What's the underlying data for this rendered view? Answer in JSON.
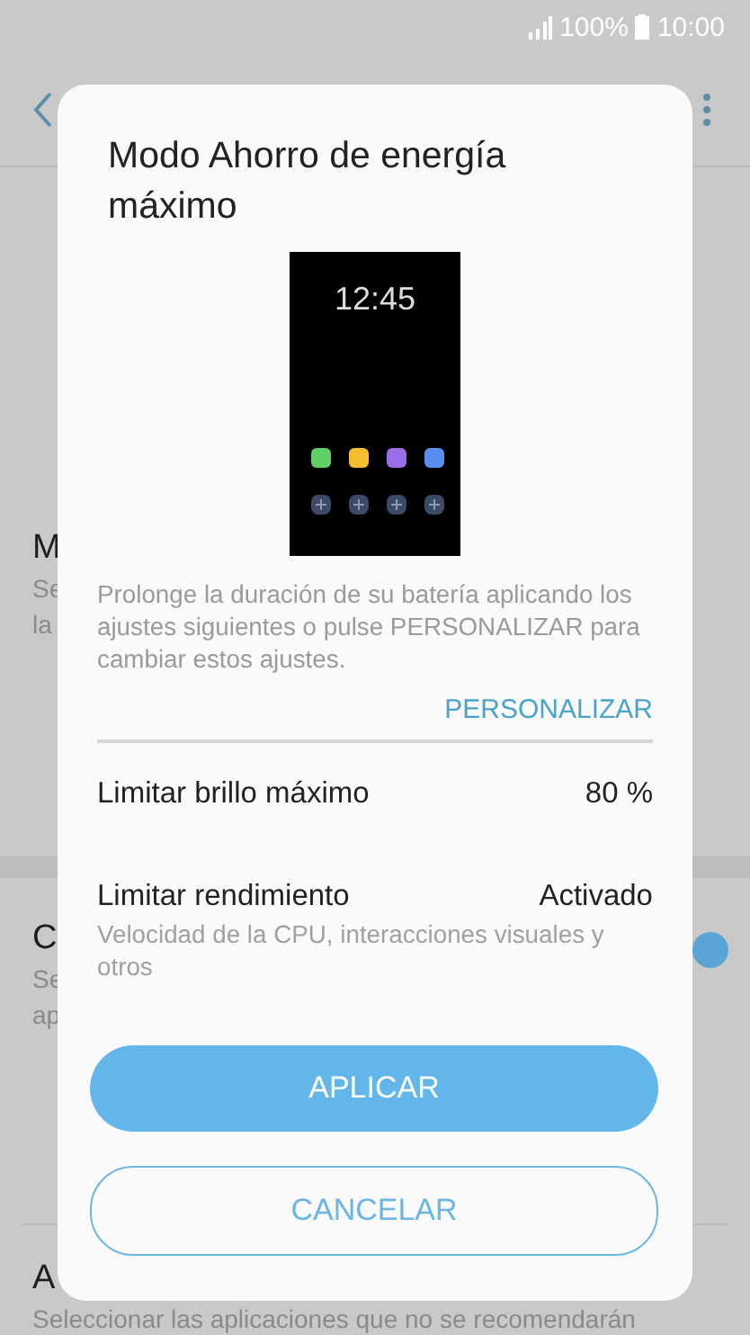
{
  "status_bar": {
    "battery": "100%",
    "time": "10:00"
  },
  "background_list": [
    {
      "title": "M",
      "subtitle_lines": [
        "Se",
        "la"
      ],
      "switch_on": false
    },
    {
      "title": "C",
      "subtitle_lines": [
        "Se",
        "ap"
      ],
      "switch_on": true
    },
    {
      "title": "A",
      "subtitle_lines": [
        "Seleccionar las aplicaciones que no se recomendarán"
      ],
      "switch_on": false
    }
  ],
  "dialog": {
    "title": "Modo Ahorro de energía máximo",
    "preview_time": "12:45",
    "description": "Prolonge la duración de su batería aplicando los ajustes siguientes o pulse PERSONALIZAR para cambiar estos ajustes.",
    "customize": "PERSONALIZAR",
    "settings": [
      {
        "label": "Limitar brillo máximo",
        "value": "80 %"
      },
      {
        "label": "Limitar rendimiento",
        "value": "Activado",
        "description": "Velocidad de la CPU, interacciones visuales y otros"
      }
    ],
    "buttons": [
      {
        "label": "APLICAR",
        "kind": "filled"
      },
      {
        "label": "CANCELAR",
        "kind": "outlined"
      }
    ]
  }
}
